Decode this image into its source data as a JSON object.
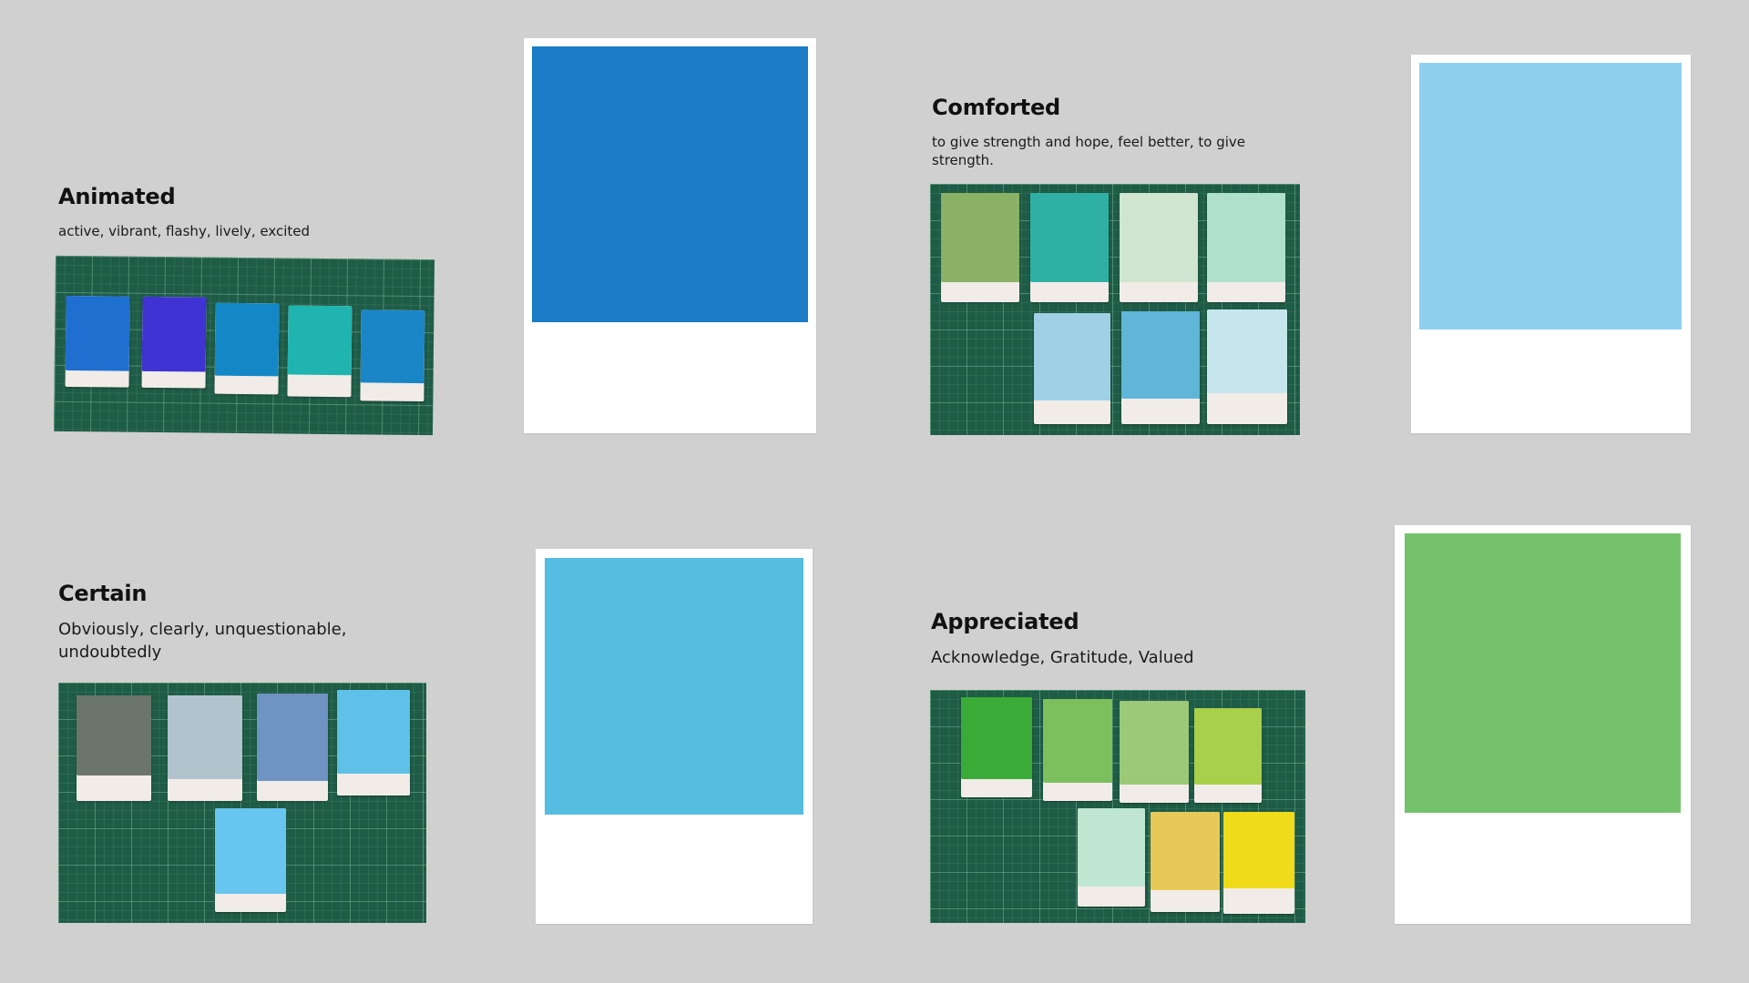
{
  "sections": [
    {
      "title": "Animated",
      "description": "active, vibrant, flashy, lively, excited",
      "swatches": [
        "#1f6fd1",
        "#3f33d4",
        "#1488c6",
        "#1fb4b0",
        "#1a86c8"
      ],
      "card_color": "#1a7cc6"
    },
    {
      "title": "Comforted",
      "description": "to give strength and hope, feel better, to give strength.",
      "swatches": [
        "#8ab166",
        "#2fb0a5",
        "#cfe5cf",
        "#aee0cd",
        "#9fd0e6",
        "#5fb6d8",
        "#c7e5ec"
      ],
      "card_color": "#8fd0ef"
    },
    {
      "title": "Certain",
      "description": "Obviously, clearly, unquestionable, undoubtedly",
      "swatches": [
        "#6b756c",
        "#b1c4ce",
        "#6f93c3",
        "#5fc1e8",
        "#67c5ef"
      ],
      "card_color": "#55bde0"
    },
    {
      "title": "Appreciated",
      "description": "Acknowledge, Gratitude, Valued",
      "swatches": [
        "#3aab36",
        "#7cc05e",
        "#9bc977",
        "#a9d04a",
        "#bfe6d0",
        "#e7c957",
        "#efdb1a"
      ],
      "card_color": "#74c26c"
    }
  ]
}
